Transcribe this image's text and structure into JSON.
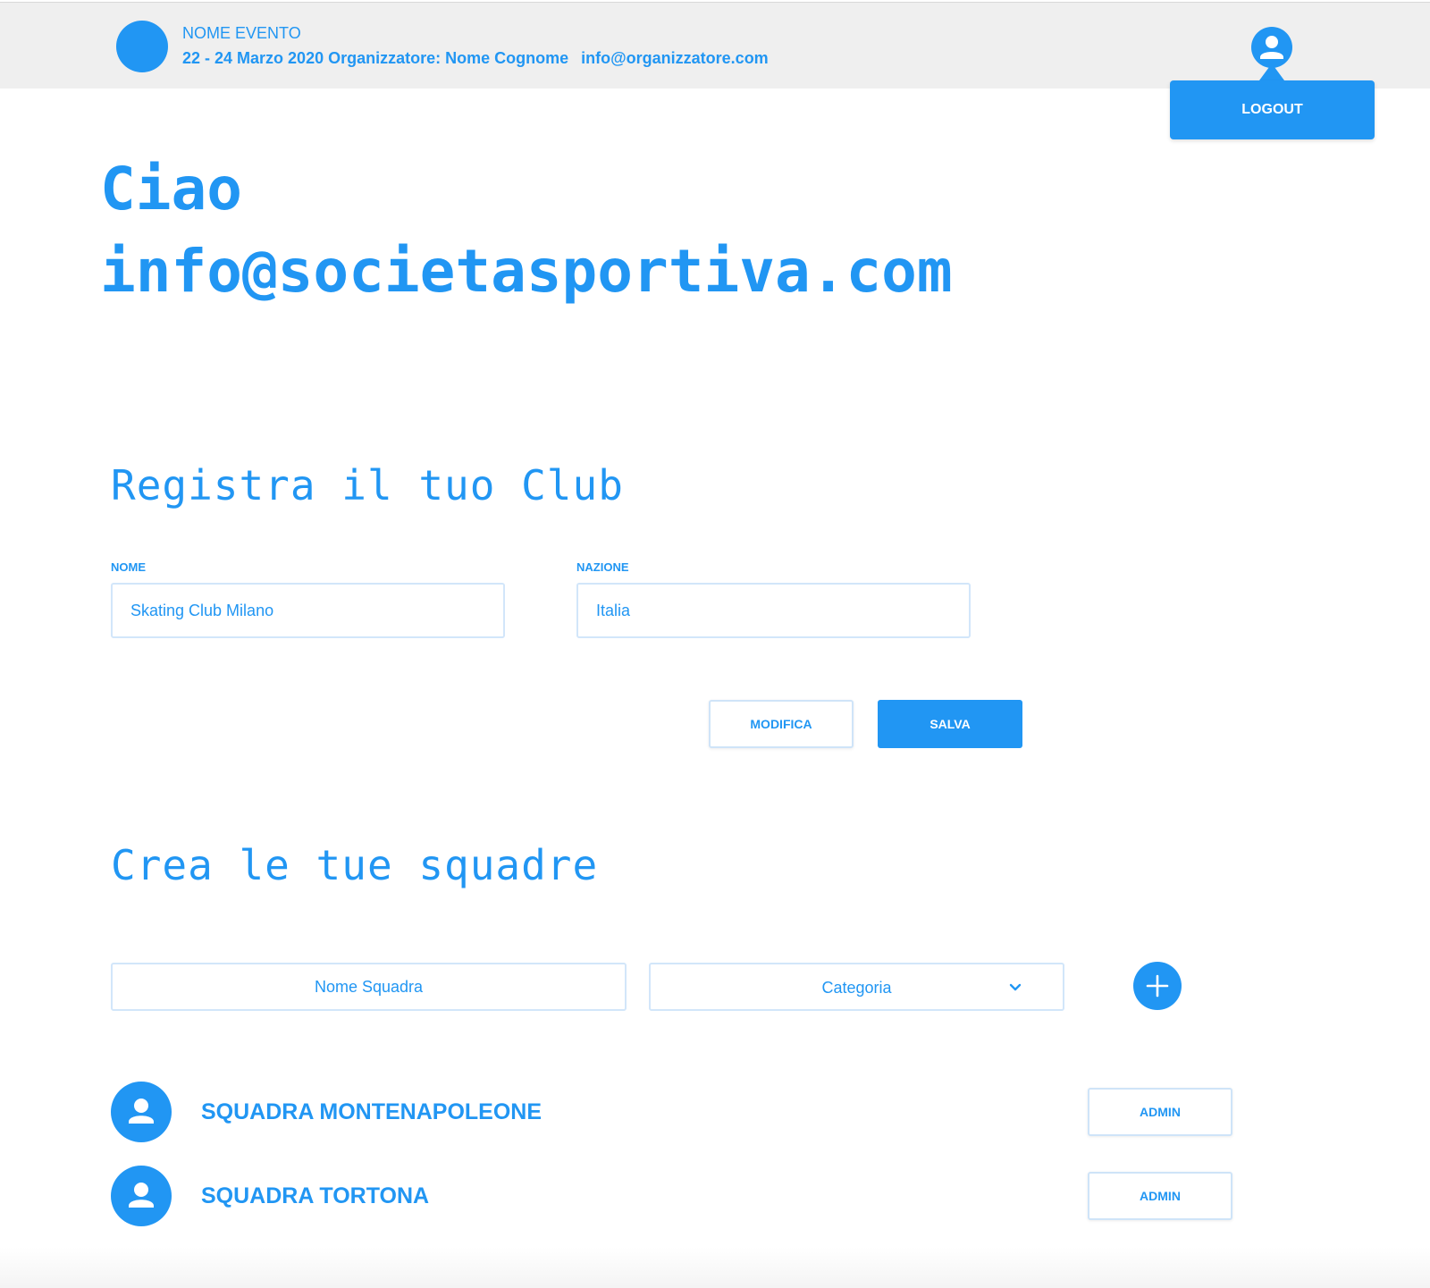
{
  "header": {
    "event_name": "NOME EVENTO",
    "event_details": "22 - 24 Marzo 2020 Organizzatore: Nome Cognome",
    "organizer_email": "info@organizzatore.com",
    "logout_label": "LOGOUT"
  },
  "greeting": {
    "line1": "Ciao",
    "line2": "info@societasportiva.com"
  },
  "club_form": {
    "title": "Registra il tuo Club",
    "name_label": "NOME",
    "name_value": "Skating Club Milano",
    "country_label": "NAZIONE",
    "country_value": "Italia",
    "edit_label": "MODIFICA",
    "save_label": "SALVA"
  },
  "teams": {
    "title": "Crea le tue squadre",
    "team_name_placeholder": "Nome Squadra",
    "category_placeholder": "Categoria",
    "items": [
      {
        "name": "SQUADRA MONTENAPOLEONE",
        "action": "ADMIN"
      },
      {
        "name": "SQUADRA TORTONA",
        "action": "ADMIN"
      }
    ]
  },
  "colors": {
    "accent": "#2196f3",
    "header_bg": "#efefef",
    "input_border": "#d2e6fa"
  },
  "icons": {
    "user": "user-icon",
    "add": "plus-icon",
    "dropdown": "chevron-down-icon"
  }
}
